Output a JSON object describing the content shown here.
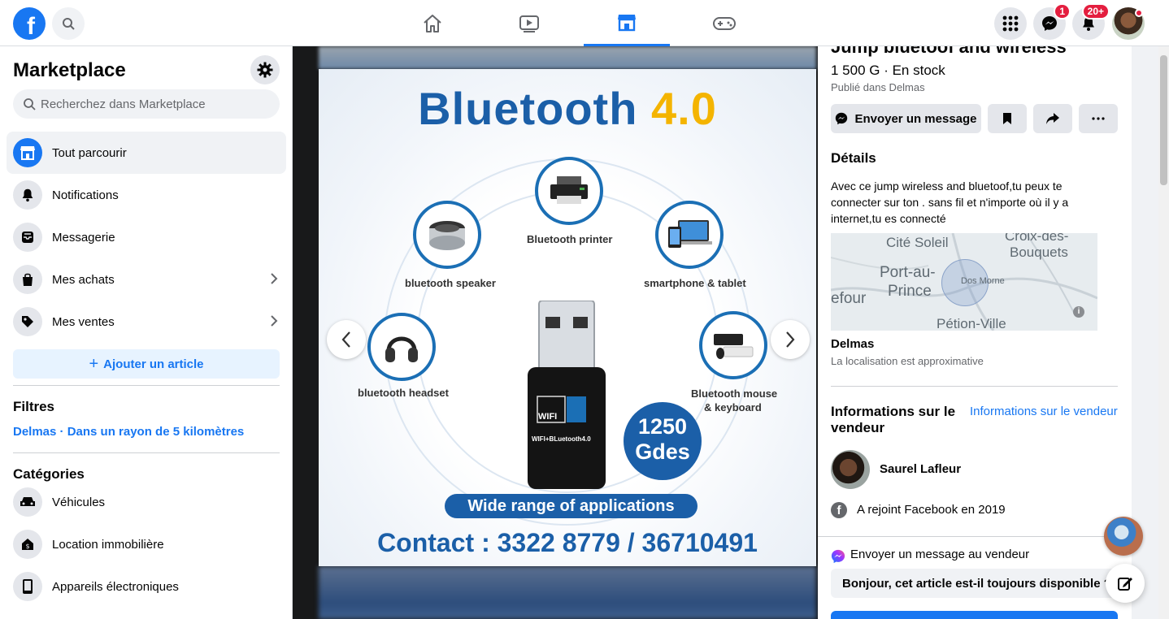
{
  "topbar": {
    "logo": "f",
    "badges": {
      "messenger": "1",
      "notifications": "20+"
    }
  },
  "sidebar": {
    "title": "Marketplace",
    "search_placeholder": "Recherchez dans Marketplace",
    "items": [
      {
        "label": "Tout parcourir",
        "icon": "storefront-icon",
        "active": true
      },
      {
        "label": "Notifications",
        "icon": "bell-icon"
      },
      {
        "label": "Messagerie",
        "icon": "inbox-icon"
      },
      {
        "label": "Mes achats",
        "icon": "bag-icon"
      },
      {
        "label": "Mes ventes",
        "icon": "tag-icon"
      }
    ],
    "add_label": "Ajouter un article",
    "filters_heading": "Filtres",
    "filter_value": "Delmas · Dans un rayon de 5 kilomètres",
    "categories_heading": "Catégories",
    "categories": [
      {
        "label": "Véhicules",
        "icon": "car-icon"
      },
      {
        "label": "Location immobilière",
        "icon": "house-icon"
      },
      {
        "label": "Appareils électroniques",
        "icon": "phone-icon"
      }
    ]
  },
  "product_image": {
    "title_main": "Bluetooth",
    "title_version": "4.0",
    "devices": {
      "printer": "Bluetooth printer",
      "speaker": "bluetooth speaker",
      "phone": "smartphone & tablet",
      "headset": "bluetooth headset",
      "mouse": "Bluetooth mouse",
      "keyboard": "& keyboard"
    },
    "dongle_wifi": "WIFI",
    "dongle_text": "WIFI+BLuetooth4.0",
    "price_line1": "1250",
    "price_line2": "Gdes",
    "range_text": "Wide range of applications",
    "contact": "Contact : 3322 8779 / 36710491"
  },
  "details": {
    "title": "Jump bluetoof and wireless",
    "price": "1 500 G · En stock",
    "published": "Publié dans Delmas",
    "message_button": "Envoyer un message",
    "details_heading": "Détails",
    "description": "Avec ce jump wireless and bluetoof,tu peux te connecter sur ton . sans fil et n'importe où il y a internet,tu es connecté",
    "map": {
      "cite_soleil": "Cité Soleil",
      "croix_1": "Croix-des-",
      "croix_2": "Bouquets",
      "pap_1": "Port-au-",
      "pap_2": "Prince",
      "dos_morne": "Dos Morne",
      "carrefour": "efour",
      "petion": "Pétion-Ville"
    },
    "location": "Delmas",
    "location_note": "La localisation est approximative",
    "seller_heading": "Informations sur le vendeur",
    "seller_link": "Informations sur le vendeur",
    "seller_name": "Saurel Lafleur",
    "joined": "A rejoint Facebook en 2019",
    "message_seller": "Envoyer un message au vendeur",
    "message_input": "Bonjour, cet article est-il toujours disponible ?"
  }
}
